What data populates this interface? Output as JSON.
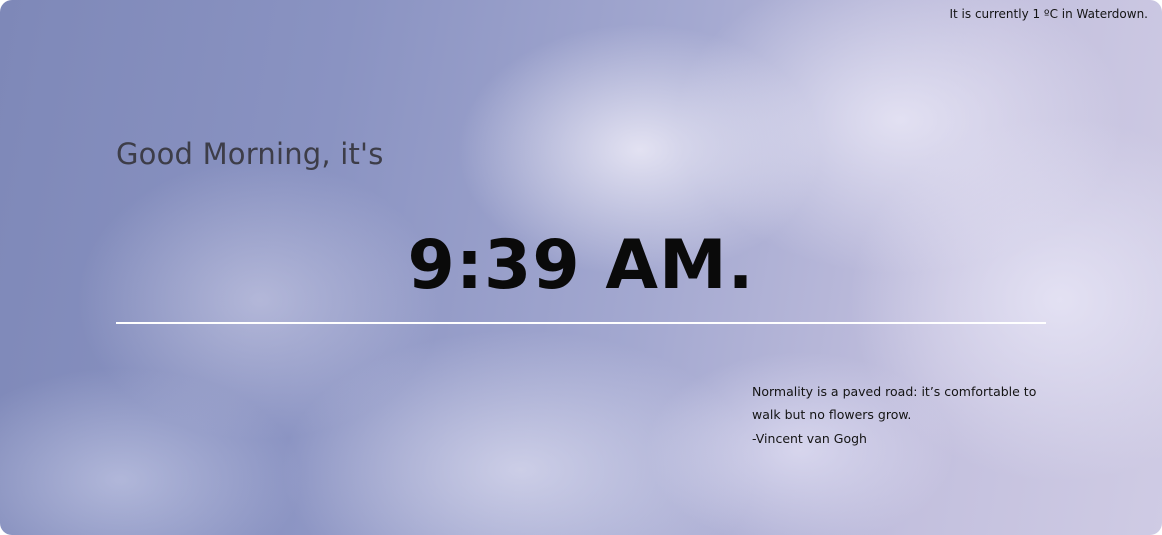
{
  "weather": {
    "text": "It is currently 1 ºC in Waterdown."
  },
  "greeting": {
    "text": "Good Morning, it's"
  },
  "clock": {
    "time": "9:39 AM."
  },
  "quote": {
    "text": "Normality is a paved road: it’s comfortable to walk but no flowers grow.",
    "author": "-Vincent van Gogh"
  },
  "colors": {
    "text_dark": "#0a0a0a",
    "greeting_text": "#3d3d48",
    "divider": "#ffffff",
    "sky_left": "#7e88b8",
    "sky_right": "#cfcbe4"
  },
  "icons": {
    "background": "sky-clouds-background"
  }
}
